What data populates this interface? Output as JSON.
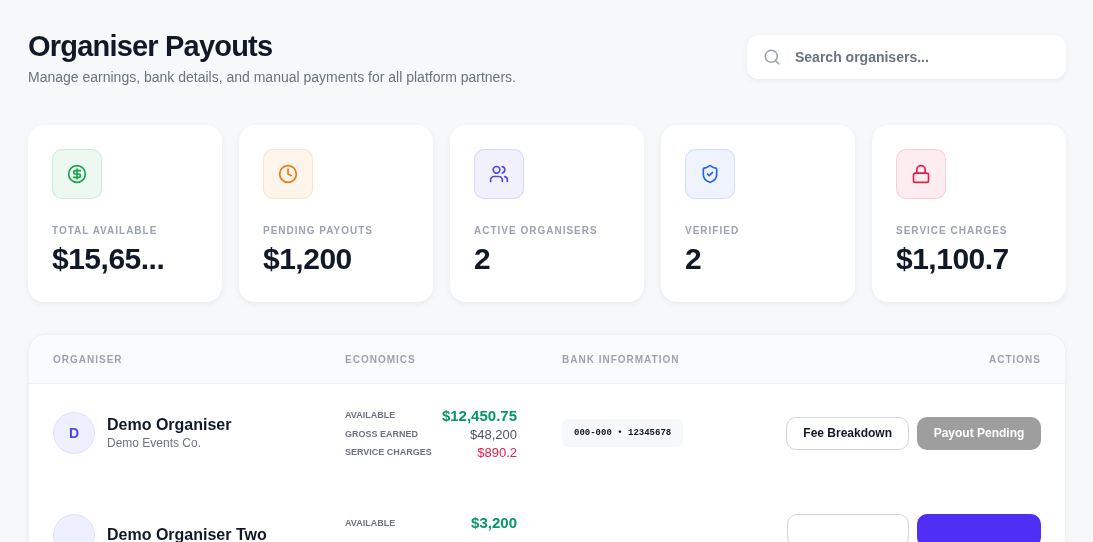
{
  "header": {
    "title": "Organiser Payouts",
    "subtitle": "Manage earnings, bank details, and manual payments for all platform partners."
  },
  "search": {
    "placeholder": "Search organisers..."
  },
  "stats": [
    {
      "kind": "dollar",
      "color": "#16a34a",
      "label": "TOTAL AVAILABLE",
      "value": "$15,65..."
    },
    {
      "kind": "clock",
      "color": "#ea7a12",
      "label": "PENDING PAYOUTS",
      "value": "$1,200"
    },
    {
      "kind": "users",
      "color": "#4f46e5",
      "label": "ACTIVE ORGANISERS",
      "value": "2"
    },
    {
      "kind": "shield",
      "color": "#2563eb",
      "label": "VERIFIED",
      "value": "2"
    },
    {
      "kind": "lock",
      "color": "#e11d48",
      "label": "SERVICE CHARGES",
      "value": "$1,100.7"
    }
  ],
  "table": {
    "columns": [
      "ORGANISER",
      "ECONOMICS",
      "BANK INFORMATION",
      "ACTIONS"
    ],
    "rows": [
      {
        "initial": "D",
        "name": "Demo Organiser",
        "company": "Demo Events Co.",
        "economics": [
          {
            "kind": "available",
            "label": "AVAILABLE",
            "value": "$12,450.75"
          },
          {
            "kind": "gross",
            "label": "GROSS EARNED",
            "value": "$48,200"
          },
          {
            "kind": "charges",
            "label": "SERVICE CHARGES",
            "value": "$890.2"
          }
        ],
        "bank": "000-000 • 12345678",
        "actions": [
          {
            "kind": "outline",
            "label": "Fee Breakdown"
          },
          {
            "kind": "primary",
            "label": "Payout Pending",
            "disabled": true
          }
        ]
      },
      {
        "name": "Demo Organiser Two",
        "economics": [
          {
            "kind": "available",
            "label": "AVAILABLE",
            "value": "$3,200"
          }
        ],
        "actions": [
          {
            "kind": "outline"
          },
          {
            "kind": "primary",
            "disabled": false
          }
        ]
      }
    ]
  }
}
